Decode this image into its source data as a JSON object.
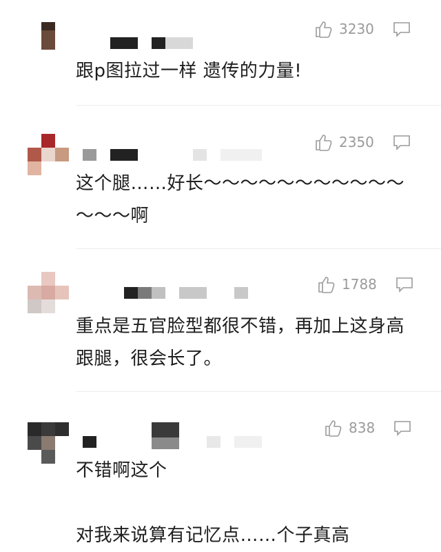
{
  "comments": [
    {
      "likes": "3230",
      "text": "跟p图拉过一样 遗传的力量!"
    },
    {
      "likes": "2350",
      "text": "这个腿……好长～～～～～～～～～～～～～～啊"
    },
    {
      "likes": "1788",
      "text": "重点是五官脸型都很不错，再加上这身高跟腿，很会长了。"
    },
    {
      "likes": "838",
      "text": "不错啊这个\n\n对我来说算有记忆点……个子真高"
    }
  ],
  "icons": {
    "like": "thumbs-up-icon",
    "reply": "reply-bubble-icon"
  },
  "colors": {
    "muted": "#9a9a9a",
    "text": "#1e1e1e",
    "divider": "#ececec"
  }
}
